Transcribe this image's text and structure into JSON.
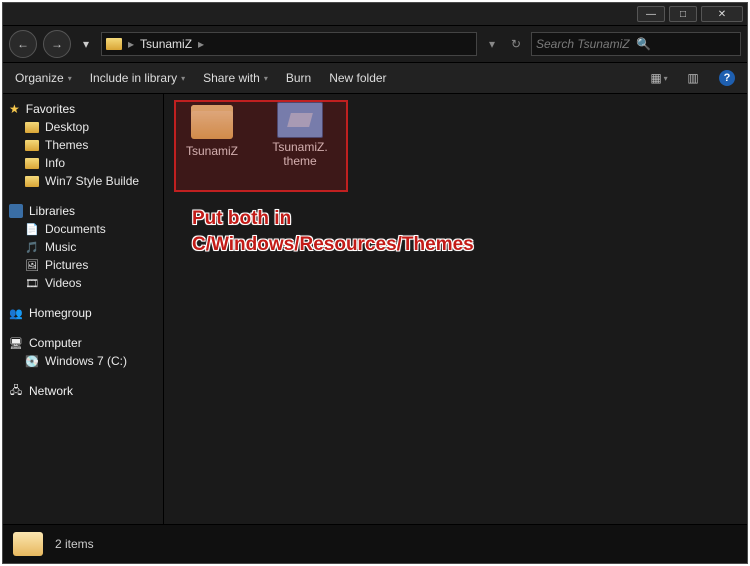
{
  "title_buttons": {
    "min": "—",
    "max": "□",
    "close": "✕"
  },
  "nav": {
    "back": "←",
    "forward": "→",
    "breadcrumb": [
      "TsunamiZ"
    ],
    "sep": "▸",
    "refresh": "↻",
    "dropdown": "▾"
  },
  "search": {
    "placeholder": "Search TsunamiZ",
    "icon": "🔍"
  },
  "toolbar": {
    "organize": "Organize",
    "include": "Include in library",
    "share": "Share with",
    "burn": "Burn",
    "newfolder": "New folder",
    "view_icon": "▦",
    "view_drop": "▾",
    "preview_icon": "▥",
    "help": "?"
  },
  "sidebar": {
    "favorites": {
      "label": "Favorites",
      "star": "★",
      "items": [
        "Desktop",
        "Themes",
        "Info",
        "Win7 Style Builde"
      ]
    },
    "libraries": {
      "label": "Libraries",
      "items": [
        {
          "label": "Documents",
          "glyph": "📄"
        },
        {
          "label": "Music",
          "glyph": "🎵"
        },
        {
          "label": "Pictures",
          "glyph": "🖼"
        },
        {
          "label": "Videos",
          "glyph": "🎞"
        }
      ]
    },
    "homegroup": {
      "label": "Homegroup",
      "glyph": "👥"
    },
    "computer": {
      "label": "Computer",
      "glyph": "🖥",
      "items": [
        {
          "label": "Windows 7 (C:)",
          "glyph": "💽"
        }
      ]
    },
    "network": {
      "label": "Network",
      "glyph": "🖧"
    }
  },
  "content": {
    "items": [
      {
        "label": "TsunamiZ",
        "type": "folder"
      },
      {
        "label": "TsunamiZ.\ntheme",
        "type": "theme"
      }
    ],
    "hint_line1": "Put both in",
    "hint_line2": "C/Windows/Resources/Themes"
  },
  "status": {
    "text": "2 items"
  }
}
